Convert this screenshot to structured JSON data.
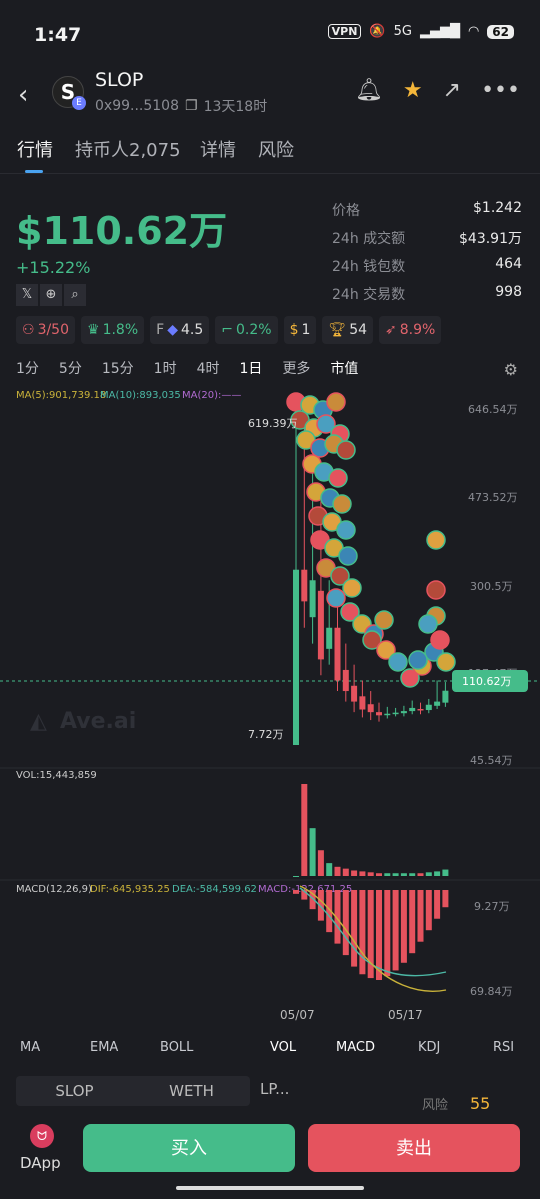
{
  "status": {
    "time": "1:47",
    "vpn": "VPN",
    "network": "5G",
    "battery": "62"
  },
  "header": {
    "token_name": "SLOP",
    "address": "0x99...5108",
    "age": "13天18时",
    "logo_glyph": "S",
    "logo_badge": "E"
  },
  "tabs": [
    {
      "label": "行情"
    },
    {
      "label": "持币人2,075"
    },
    {
      "label": "详情"
    },
    {
      "label": "风险"
    }
  ],
  "summary": {
    "market_cap": "$110.62万",
    "change": "+15.22%"
  },
  "socials": [
    "x-icon",
    "globe-icon",
    "search-icon"
  ],
  "stats": [
    {
      "label": "价格",
      "value": "$1.242"
    },
    {
      "label": "24h 成交额",
      "value": "$43.91万"
    },
    {
      "label": "24h 钱包数",
      "value": "464"
    },
    {
      "label": "24h 交易数",
      "value": "998"
    }
  ],
  "badges": {
    "holders_flag": "3/50",
    "top_pct": "1.8%",
    "f_label": "F",
    "f_value": "4.5",
    "gun_pct": "0.2%",
    "bag_count": "1",
    "trophy_count": "54",
    "rocket_pct": "8.9%"
  },
  "intervals": [
    "1分",
    "5分",
    "15分",
    "1时",
    "4时",
    "1日",
    "更多",
    "市值"
  ],
  "ma_legend": {
    "ma5": "MA(5):901,739.18",
    "ma10": "MA(10):893,035",
    "ma20": "MA(20):——"
  },
  "chart": {
    "high_label": "619.39万",
    "low_label": "7.72万",
    "current_label": "110.62万",
    "y_ticks": [
      "646.54万",
      "473.52万",
      "300.5万",
      "127.47万",
      "45.54万"
    ],
    "watermark": "Ave.ai",
    "vol_label": "VOL:15,443,859",
    "macd_label": "MACD(12,26,9)",
    "dif_label": "DIF:-645,935.25",
    "dea_label": "DEA:-584,599.62",
    "macd_value": "MACD:-122,671.25",
    "macd_ticks": [
      "9.27万",
      "69.84万"
    ],
    "x_ticks": [
      "05/07",
      "05/17"
    ]
  },
  "chart_data": {
    "type": "candlestick",
    "x_ticks": [
      "05/07",
      "05/17"
    ],
    "y_unit": "万",
    "ylim": [
      7.72,
      646.54
    ],
    "candles": [
      {
        "open": 7.72,
        "close": 340,
        "high": 610,
        "low": 7.72
      },
      {
        "open": 340,
        "close": 280,
        "high": 619.39,
        "low": 230
      },
      {
        "open": 250,
        "close": 320,
        "high": 540,
        "low": 200
      },
      {
        "open": 300,
        "close": 170,
        "high": 470,
        "low": 140
      },
      {
        "open": 190,
        "close": 230,
        "high": 320,
        "low": 160
      },
      {
        "open": 230,
        "close": 130,
        "high": 290,
        "low": 110
      },
      {
        "open": 150,
        "close": 110,
        "high": 200,
        "low": 90
      },
      {
        "open": 120,
        "close": 90,
        "high": 160,
        "low": 70
      },
      {
        "open": 100,
        "close": 75,
        "high": 130,
        "low": 60
      },
      {
        "open": 85,
        "close": 70,
        "high": 110,
        "low": 55
      },
      {
        "open": 70,
        "close": 64,
        "high": 88,
        "low": 52
      },
      {
        "open": 66,
        "close": 67,
        "high": 80,
        "low": 58
      },
      {
        "open": 67,
        "close": 69,
        "high": 78,
        "low": 62
      },
      {
        "open": 68,
        "close": 72,
        "high": 82,
        "low": 62
      },
      {
        "open": 72,
        "close": 78,
        "high": 92,
        "low": 66
      },
      {
        "open": 76,
        "close": 74,
        "high": 88,
        "low": 66
      },
      {
        "open": 74,
        "close": 84,
        "high": 95,
        "low": 68
      },
      {
        "open": 82,
        "close": 90,
        "high": 130,
        "low": 76
      },
      {
        "open": 88,
        "close": 110.62,
        "high": 127,
        "low": 80
      }
    ],
    "volume": [
      0,
      100,
      52,
      28,
      14,
      10,
      8,
      6,
      5,
      4,
      3,
      3,
      3,
      3,
      3,
      3,
      4,
      5,
      7
    ],
    "macd_hist": [
      -2,
      -5,
      -10,
      -16,
      -22,
      -28,
      -34,
      -40,
      -44,
      -46,
      -47,
      -45,
      -42,
      -38,
      -33,
      -27,
      -21,
      -15,
      -9
    ]
  },
  "indicators": [
    "MA",
    "EMA",
    "BOLL",
    "VOL",
    "MACD",
    "KDJ",
    "RSI"
  ],
  "pair": {
    "left": "SLOP",
    "right": "WETH",
    "lp": "LP...",
    "risk_label": "风险",
    "risk_value": "55"
  },
  "bottom": {
    "dapp": "DApp",
    "buy": "买入",
    "sell": "卖出"
  },
  "colors": {
    "up": "#45bc8a",
    "down": "#e5535e",
    "accent": "#4aa3f0",
    "gold": "#f4b63a"
  }
}
